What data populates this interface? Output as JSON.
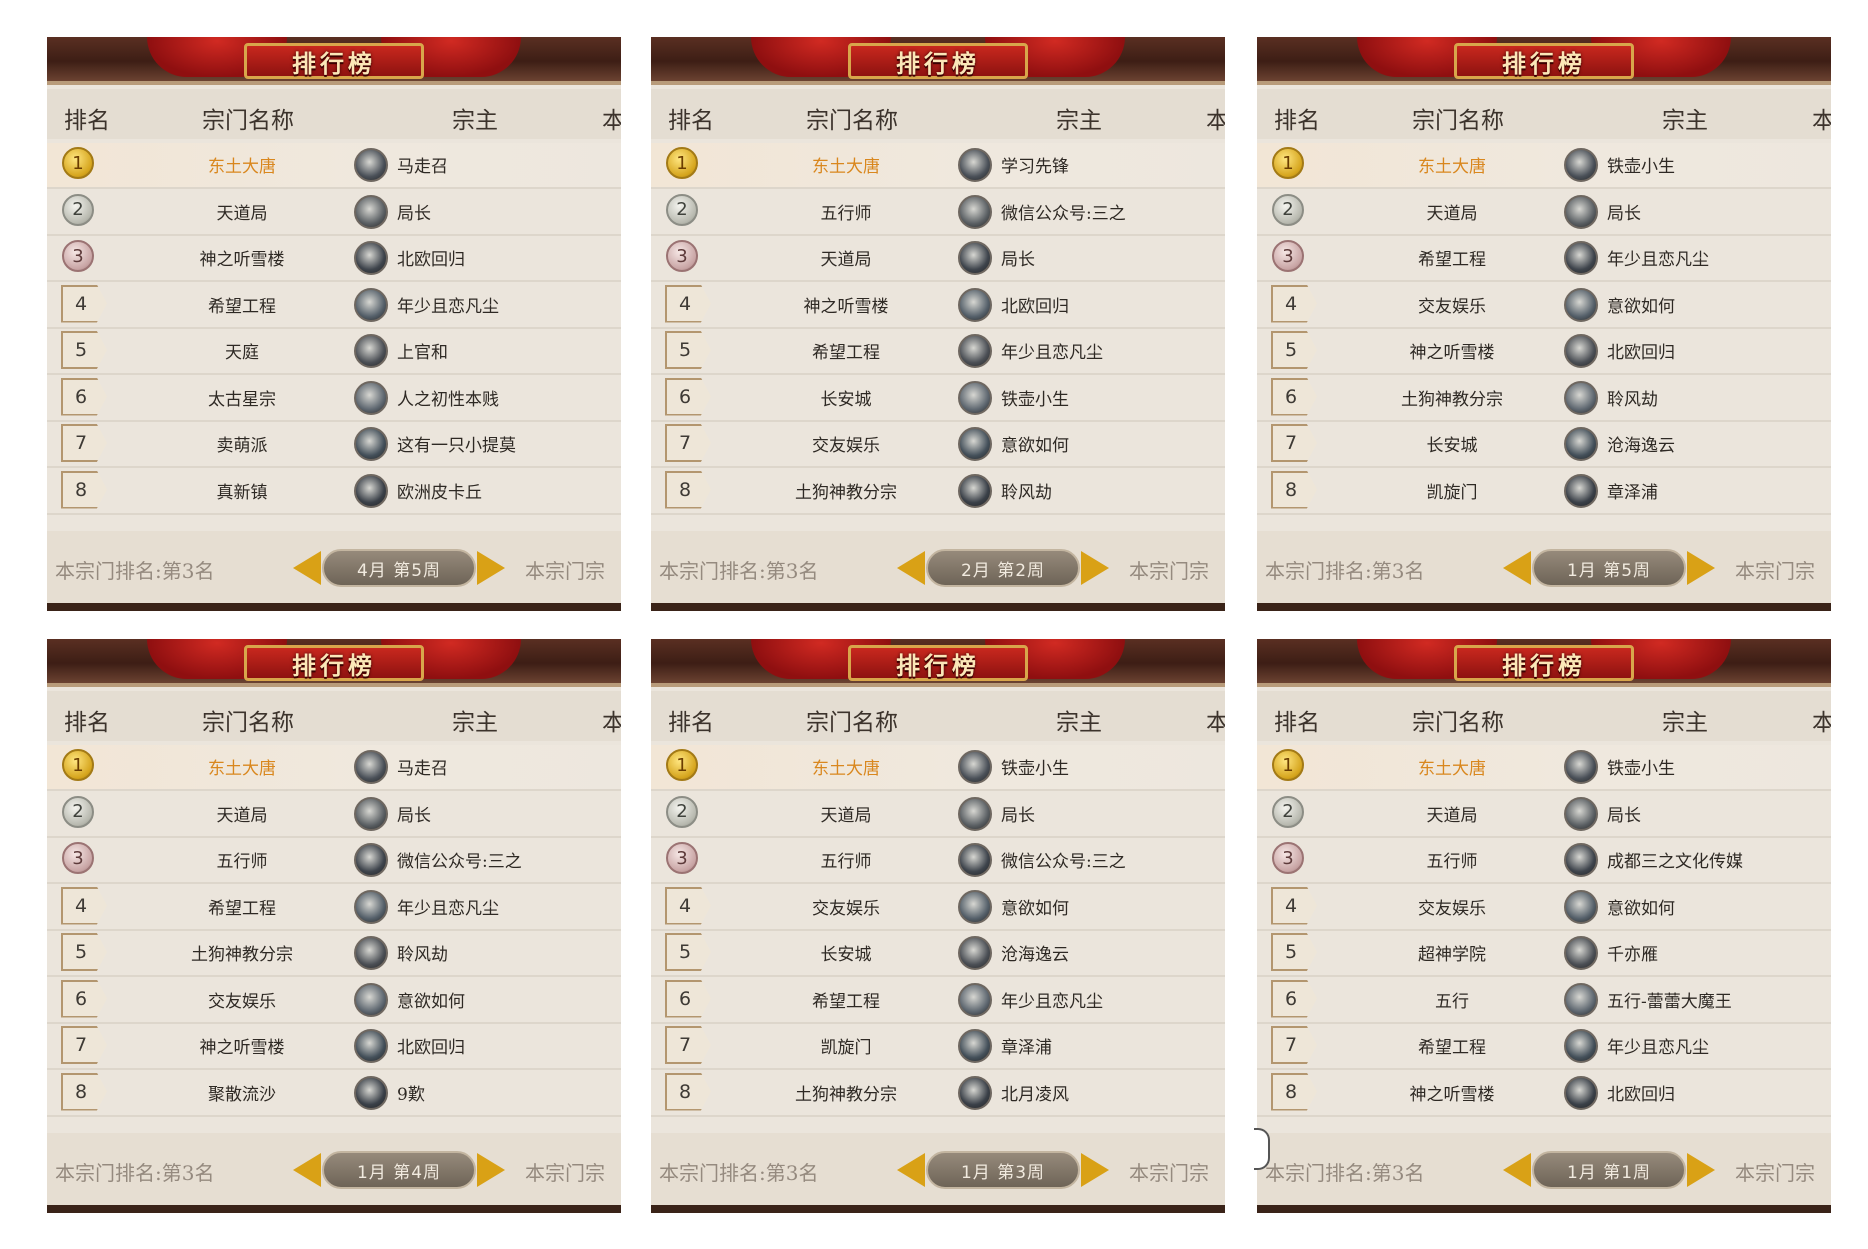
{
  "header": {
    "title": "排行榜",
    "col_rank": "排名",
    "col_sect": "宗门名称",
    "col_master": "宗主",
    "col_extra": "本"
  },
  "footer": {
    "my_rank_label": "本宗门排名:第3名",
    "my_sect_clipped": "本宗门宗"
  },
  "colors": {
    "gold_text": "#d9871e",
    "arrow": "#d9a116"
  },
  "panels": [
    {
      "week": "4月  第5周",
      "rows": [
        {
          "rank": "1",
          "sect": "东土大唐",
          "master": "马走召"
        },
        {
          "rank": "2",
          "sect": "天道局",
          "master": "局长"
        },
        {
          "rank": "3",
          "sect": "神之听雪楼",
          "master": "北欧回归"
        },
        {
          "rank": "4",
          "sect": "希望工程",
          "master": "年少且恋凡尘"
        },
        {
          "rank": "5",
          "sect": "天庭",
          "master": "上官和"
        },
        {
          "rank": "6",
          "sect": "太古星宗",
          "master": "人之初性本贱"
        },
        {
          "rank": "7",
          "sect": "卖萌派",
          "master": "这有一只小提莫"
        },
        {
          "rank": "8",
          "sect": "真新镇",
          "master": "欧洲皮卡丘"
        }
      ]
    },
    {
      "week": "2月  第2周",
      "rows": [
        {
          "rank": "1",
          "sect": "东土大唐",
          "master": "学习先锋"
        },
        {
          "rank": "2",
          "sect": "五行师",
          "master": "微信公众号:三之"
        },
        {
          "rank": "3",
          "sect": "天道局",
          "master": "局长"
        },
        {
          "rank": "4",
          "sect": "神之听雪楼",
          "master": "北欧回归"
        },
        {
          "rank": "5",
          "sect": "希望工程",
          "master": "年少且恋凡尘"
        },
        {
          "rank": "6",
          "sect": "长安城",
          "master": "铁壶小生"
        },
        {
          "rank": "7",
          "sect": "交友娱乐",
          "master": "意欲如何"
        },
        {
          "rank": "8",
          "sect": "土狗神教分宗",
          "master": "聆风劫"
        }
      ]
    },
    {
      "week": "1月  第5周",
      "rows": [
        {
          "rank": "1",
          "sect": "东土大唐",
          "master": "铁壶小生"
        },
        {
          "rank": "2",
          "sect": "天道局",
          "master": "局长"
        },
        {
          "rank": "3",
          "sect": "希望工程",
          "master": "年少且恋凡尘"
        },
        {
          "rank": "4",
          "sect": "交友娱乐",
          "master": "意欲如何"
        },
        {
          "rank": "5",
          "sect": "神之听雪楼",
          "master": "北欧回归"
        },
        {
          "rank": "6",
          "sect": "土狗神教分宗",
          "master": "聆风劫"
        },
        {
          "rank": "7",
          "sect": "长安城",
          "master": "沧海逸云"
        },
        {
          "rank": "8",
          "sect": "凯旋门",
          "master": "章泽浦"
        }
      ]
    },
    {
      "week": "1月  第4周",
      "rows": [
        {
          "rank": "1",
          "sect": "东土大唐",
          "master": "马走召"
        },
        {
          "rank": "2",
          "sect": "天道局",
          "master": "局长"
        },
        {
          "rank": "3",
          "sect": "五行师",
          "master": "微信公众号:三之"
        },
        {
          "rank": "4",
          "sect": "希望工程",
          "master": "年少且恋凡尘"
        },
        {
          "rank": "5",
          "sect": "土狗神教分宗",
          "master": "聆风劫"
        },
        {
          "rank": "6",
          "sect": "交友娱乐",
          "master": "意欲如何"
        },
        {
          "rank": "7",
          "sect": "神之听雪楼",
          "master": "北欧回归"
        },
        {
          "rank": "8",
          "sect": "聚散流沙",
          "master": "9歎"
        }
      ]
    },
    {
      "week": "1月  第3周",
      "rows": [
        {
          "rank": "1",
          "sect": "东土大唐",
          "master": "铁壶小生"
        },
        {
          "rank": "2",
          "sect": "天道局",
          "master": "局长"
        },
        {
          "rank": "3",
          "sect": "五行师",
          "master": "微信公众号:三之"
        },
        {
          "rank": "4",
          "sect": "交友娱乐",
          "master": "意欲如何"
        },
        {
          "rank": "5",
          "sect": "长安城",
          "master": "沧海逸云"
        },
        {
          "rank": "6",
          "sect": "希望工程",
          "master": "年少且恋凡尘"
        },
        {
          "rank": "7",
          "sect": "凯旋门",
          "master": "章泽浦"
        },
        {
          "rank": "8",
          "sect": "土狗神教分宗",
          "master": "北月凌风"
        }
      ]
    },
    {
      "week": "1月  第1周",
      "rows": [
        {
          "rank": "1",
          "sect": "东土大唐",
          "master": "铁壶小生"
        },
        {
          "rank": "2",
          "sect": "天道局",
          "master": "局长"
        },
        {
          "rank": "3",
          "sect": "五行师",
          "master": "成都三之文化传媒"
        },
        {
          "rank": "4",
          "sect": "交友娱乐",
          "master": "意欲如何"
        },
        {
          "rank": "5",
          "sect": "超神学院",
          "master": "千亦雁"
        },
        {
          "rank": "6",
          "sect": "五行",
          "master": "五行-蕾蕾大魔王"
        },
        {
          "rank": "7",
          "sect": "希望工程",
          "master": "年少且恋凡尘"
        },
        {
          "rank": "8",
          "sect": "神之听雪楼",
          "master": "北欧回归"
        }
      ]
    }
  ]
}
